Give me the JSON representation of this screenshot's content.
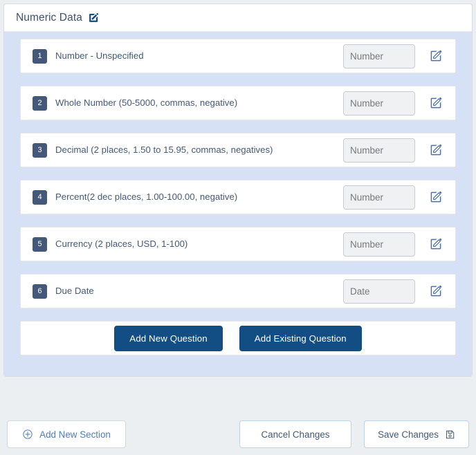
{
  "section": {
    "title": "Numeric Data",
    "edit_icon": "edit-square-pencil-icon"
  },
  "questions": [
    {
      "number": "1",
      "label": "Number - Unspecified",
      "input_placeholder": "Number",
      "edit_icon": "edit-square-pencil-icon"
    },
    {
      "number": "2",
      "label": "Whole Number (50-5000, commas, negative)",
      "input_placeholder": "Number",
      "edit_icon": "edit-square-pencil-icon"
    },
    {
      "number": "3",
      "label": "Decimal (2 places, 1.50 to 15.95, commas, negatives)",
      "input_placeholder": "Number",
      "edit_icon": "edit-square-pencil-icon"
    },
    {
      "number": "4",
      "label": "Percent(2 dec places, 1.00-100.00, negative)",
      "input_placeholder": "Number",
      "edit_icon": "edit-square-pencil-icon"
    },
    {
      "number": "5",
      "label": "Currency (2 places, USD, 1-100)",
      "input_placeholder": "Number",
      "edit_icon": "edit-square-pencil-icon"
    },
    {
      "number": "6",
      "label": "Due Date",
      "input_placeholder": "Date",
      "edit_icon": "edit-square-pencil-icon"
    }
  ],
  "question_actions": {
    "add_new_question": "Add New Question",
    "add_existing_question": "Add Existing Question"
  },
  "footer": {
    "add_new_section": "Add New Section",
    "add_new_section_icon": "plus-circle-icon",
    "cancel_changes": "Cancel Changes",
    "save_changes": "Save Changes",
    "save_icon": "floppy-disk-save-icon"
  },
  "colors": {
    "page_background": "#eceff1",
    "section_body_blue": "#d6e1f5",
    "card_white": "#ffffff",
    "primary_button": "#124e84",
    "badge_navy": "#44597a",
    "text_slate": "#44597a",
    "link_blue": "#4d7bc4",
    "input_fill": "#f0f1f3"
  }
}
